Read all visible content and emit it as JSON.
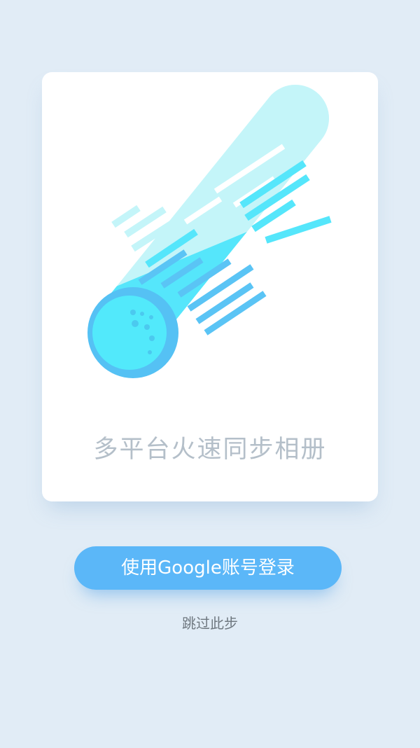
{
  "card": {
    "illustration_icon": "meteor-icon",
    "tagline": "多平台火速同步相册"
  },
  "actions": {
    "login_label": "使用Google账号登录",
    "skip_label": "跳过此步"
  },
  "colors": {
    "background": "#e1ecf6",
    "card": "#ffffff",
    "primary_button": "#5bb7f8",
    "tagline_text": "#b4bfc9",
    "meteor_head": "#52e9fb",
    "meteor_tail_light": "#bff6f9",
    "meteor_tail_dark": "#55c1f4"
  }
}
